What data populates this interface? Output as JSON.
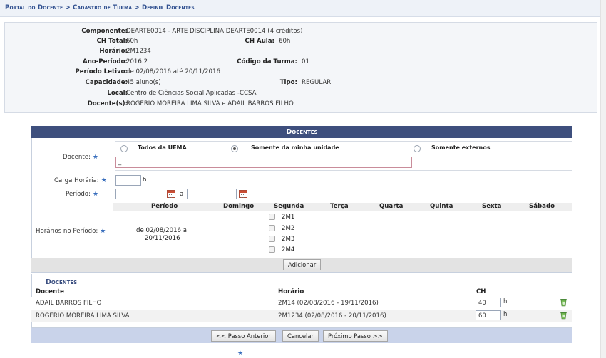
{
  "breadcrumb": "Portal do Docente > Cadastro de Turma > Definir Docentes",
  "info": {
    "componente_label": "Componente:",
    "componente": "DEARTE0014 - ARTE DISCIPLINA DEARTE0014 (4 créditos)",
    "ch_total_label": "CH Total:",
    "ch_total": "60h",
    "ch_aula_label": "CH Aula:",
    "ch_aula": "60h",
    "horario_label": "Horário:",
    "horario": "2M1234",
    "ano_periodo_label": "Ano-Período:",
    "ano_periodo": "2016.2",
    "codigo_turma_label": "Código da Turma:",
    "codigo_turma": "01",
    "periodo_letivo_label": "Período Letivo:",
    "periodo_letivo": "de 02/08/2016 até 20/11/2016",
    "capacidade_label": "Capacidade:",
    "capacidade": "45 aluno(s)",
    "tipo_label": "Tipo:",
    "tipo": "REGULAR",
    "local_label": "Local:",
    "local": "Centro de Ciências Social Aplicadas -CCSA",
    "docentes_label": "Docente(s):",
    "docentes": "ROGERIO MOREIRA LIMA SILVA e ADAIL BARROS FILHO"
  },
  "form": {
    "title": "Docentes",
    "docente_label": "Docente:",
    "radio_options": [
      "Todos da UEMA",
      "Somente da minha unidade",
      "Somente externos"
    ],
    "selected_radio": "Somente da minha unidade",
    "docente_value": "_",
    "carga_label": "Carga Horária:",
    "carga_unit": "h",
    "periodo_label": "Período:",
    "periodo_sep": "a",
    "horarios_label": "Horários no Período:",
    "table_headers": [
      "Período",
      "Domingo",
      "Segunda",
      "Terça",
      "Quarta",
      "Quinta",
      "Sexta",
      "Sábado"
    ],
    "periodo_text_1": "de 02/08/2016 a",
    "periodo_text_2": "20/11/2016",
    "slots": [
      "2M1",
      "2M2",
      "2M3",
      "2M4"
    ],
    "add_button": "Adicionar"
  },
  "docentes_list": {
    "title": "Docentes",
    "headers": {
      "docente": "Docente",
      "horario": "Horário",
      "ch": "CH"
    },
    "rows": [
      {
        "docente": "ADAIL BARROS FILHO",
        "horario": "2M14 (02/08/2016 - 19/11/2016)",
        "ch": "40",
        "unit": "h"
      },
      {
        "docente": "ROGERIO MOREIRA LIMA SILVA",
        "horario": "2M1234 (02/08/2016 - 20/11/2016)",
        "ch": "60",
        "unit": "h"
      }
    ]
  },
  "buttons": {
    "previous": "<< Passo Anterior",
    "cancel": "Cancelar",
    "next": "Próximo Passo >>"
  },
  "footer_note": "★"
}
